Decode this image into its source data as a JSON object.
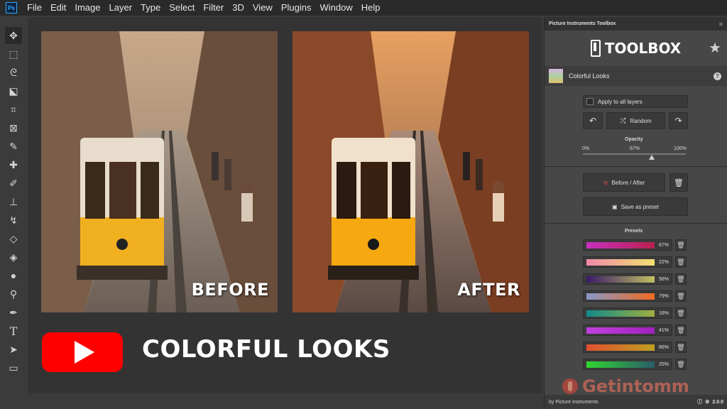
{
  "menubar": {
    "logo": "Ps",
    "items": [
      "File",
      "Edit",
      "Image",
      "Layer",
      "Type",
      "Select",
      "Filter",
      "3D",
      "View",
      "Plugins",
      "Window",
      "Help"
    ]
  },
  "toolbar": {
    "tools": [
      "move-tool",
      "marquee-tool",
      "lasso-tool",
      "object-select-tool",
      "crop-tool",
      "frame-tool",
      "eyedropper-tool",
      "healing-tool",
      "brush-tool",
      "stamp-tool",
      "history-brush-tool",
      "eraser-tool",
      "paint-bucket-tool",
      "blur-tool",
      "dodge-tool",
      "pen-tool",
      "type-tool",
      "path-select-tool",
      "rectangle-tool"
    ]
  },
  "canvas": {
    "before_label": "BEFORE",
    "after_label": "AFTER",
    "headline": "COLORFUL LOOKS"
  },
  "panel": {
    "tab_title": "Picture Instruments Toolbox",
    "toolbox_title": "TOOLBOX",
    "look_title": "Colorful Looks",
    "help_glyph": "?",
    "apply_all_label": "Apply to all layers",
    "random_label": "Random",
    "opacity_label": "Opacity",
    "opacity_min": "0%",
    "opacity_value": "67%",
    "opacity_max": "100%",
    "opacity_level": 0.67,
    "before_after_label": "Before / After",
    "save_preset_label": "Save as preset",
    "presets_label": "Presets",
    "presets": [
      {
        "pct": "67%",
        "from": "#c830c0",
        "to": "#b82050"
      },
      {
        "pct": "22%",
        "from": "#f08aa8",
        "to": "#f0e070"
      },
      {
        "pct": "56%",
        "from": "#3a1a6a",
        "to": "#c0c060"
      },
      {
        "pct": "79%",
        "from": "#8898c8",
        "to": "#f06a20"
      },
      {
        "pct": "16%",
        "from": "#108a8a",
        "to": "#a0b040"
      },
      {
        "pct": "41%",
        "from": "#c040e0",
        "to": "#a020c0"
      },
      {
        "pct": "86%",
        "from": "#e05030",
        "to": "#c0a020"
      },
      {
        "pct": "25%",
        "from": "#30d830",
        "to": "#2a5a6a"
      }
    ],
    "footer_left": "by Picture Instruments",
    "version": "2.0.0"
  },
  "watermark": "Getintomm"
}
